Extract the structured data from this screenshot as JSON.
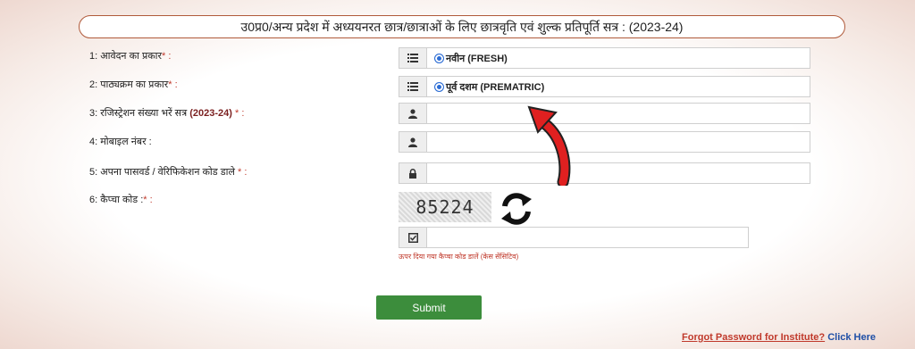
{
  "header": {
    "title": "उ0प्र0/अन्य प्रदेश में अध्ययनरत छात्र/छात्राओं के लिए छात्रवृति एवं शुल्क प्रतिपूर्ति सत्र : (2023-24)"
  },
  "form": {
    "application_type": {
      "label": "1: आवेदन का प्रकार",
      "required_mark": "* :",
      "value": "नवीन (FRESH)"
    },
    "course_type": {
      "label": "2: पाठ्यक्रम का प्रकार",
      "required_mark": "* :",
      "value": "पूर्व दशम (PREMATRIC)"
    },
    "registration": {
      "label": "3: रजिस्ट्रेशन संख्या भरें सत्र",
      "session": "(2023-24)",
      "required_mark": " * :"
    },
    "mobile": {
      "label": "4: मोबाइल नंबर :"
    },
    "password": {
      "label": "5: अपना पासवर्ड / वेरिफिकेशन कोड डाले",
      "required_mark": " * :"
    },
    "captcha": {
      "label": "6: कैप्चा कोड :",
      "required_mark": "* :",
      "code": "85224",
      "hint": "ऊपर दिया गया कैप्चा कोड डालें (केस सेंसिटिव)"
    },
    "submit_label": "Submit"
  },
  "footer": {
    "forgot_text": "Forgot Password for Institute?",
    "click_here": "Click Here"
  },
  "colors": {
    "accent_green": "#3c8d3c",
    "required_red": "#c0392b",
    "arrow_red": "#e02020"
  }
}
